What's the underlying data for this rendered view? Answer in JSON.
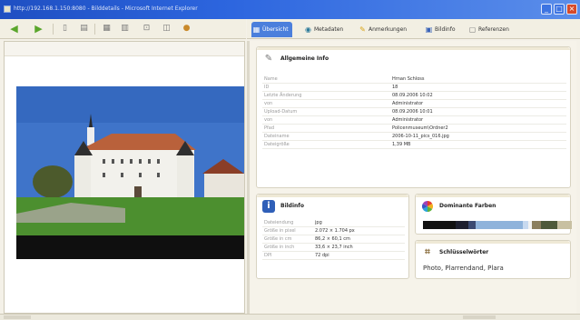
{
  "window": {
    "title": "http://192.168.1.150:8080 - Bilddetails - Microsoft Internet Explorer",
    "minimize_icon": "minimize-icon",
    "maximize_icon": "maximize-icon",
    "close_icon": "close-icon"
  },
  "toolbar": {
    "icons": [
      "back-arrow-icon",
      "forward-arrow-icon",
      "page-icon",
      "print-icon",
      "edit-icon",
      "copy-icon",
      "rotate-icon",
      "delete-icon",
      "tag-icon"
    ]
  },
  "tabs": [
    {
      "label": "Übersicht",
      "icon": "overview-icon",
      "active": true
    },
    {
      "label": "Metadaten",
      "icon": "metadata-icon",
      "active": false
    },
    {
      "label": "Anmerkungen",
      "icon": "notes-icon",
      "active": false
    },
    {
      "label": "Bildinfo",
      "icon": "imageinfo-icon",
      "active": false
    },
    {
      "label": "Referenzen",
      "icon": "references-icon",
      "active": false
    }
  ],
  "general": {
    "title": "Allgemeine Info",
    "rows": [
      {
        "k": "Name",
        "v": "Hrnan Schloss"
      },
      {
        "k": "ID",
        "v": "18"
      },
      {
        "k": "Letzte Änderung",
        "v": "08.09.2006 10:02"
      },
      {
        "k": "von",
        "v": "Administrator"
      },
      {
        "k": "Upload-Datum",
        "v": "08.09.2006 10:01"
      },
      {
        "k": "von",
        "v": "Administrator"
      },
      {
        "k": "Pfad",
        "v": "Policenmuseum\\Ordner2"
      },
      {
        "k": "Dateiname",
        "v": "2006-10-11_pics_016.jpg"
      },
      {
        "k": "Dateigröße",
        "v": "1,39 MB"
      }
    ]
  },
  "imageinfo": {
    "title": "Bildinfo",
    "rows": [
      {
        "k": "Dateiendung",
        "v": "jpg"
      },
      {
        "k": "Größe in pixel",
        "v": "2.072 × 1.704 px"
      },
      {
        "k": "Größe in cm",
        "v": "86,2 × 60,1 cm"
      },
      {
        "k": "Größe in inch",
        "v": "33,6 × 23,7 inch"
      },
      {
        "k": "DPI",
        "v": "72 dpi"
      }
    ]
  },
  "colors": {
    "title": "Dominante Farben",
    "swatches": [
      "#111111",
      "#1d1f2e",
      "#3b4a72",
      "#8fb3db",
      "#c7d9ef",
      "#f2f2f2",
      "#8b7f5e",
      "#4e5a3a",
      "#c8c0a2"
    ]
  },
  "keywords": {
    "title": "Schlüsselwörter",
    "text": "Photo, Plarrendand, Plara"
  }
}
